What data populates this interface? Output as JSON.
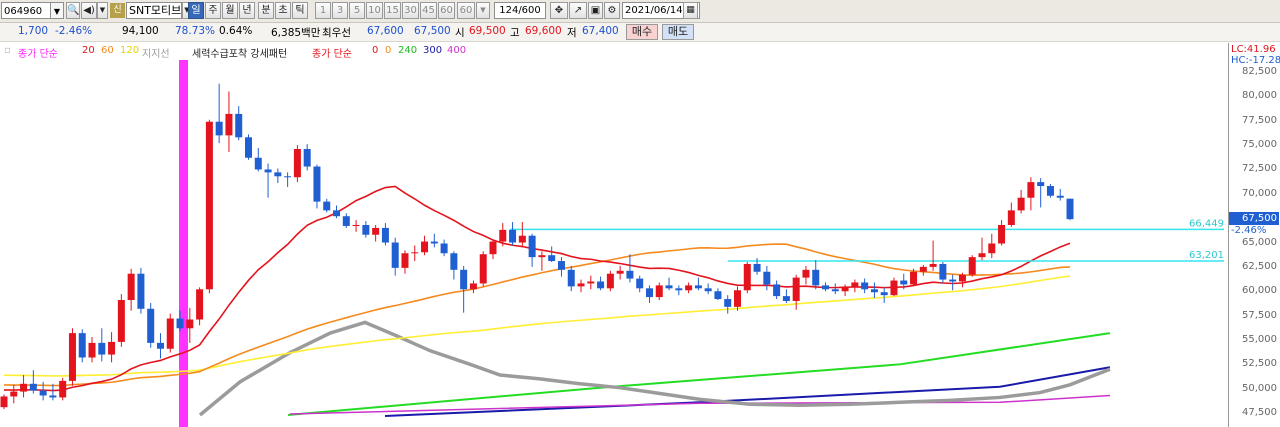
{
  "toolbar": {
    "code": "064960",
    "name": "SNT모티브",
    "sin_badge": "신",
    "periods": [
      {
        "label": "일",
        "active": true
      },
      {
        "label": "주"
      },
      {
        "label": "월"
      },
      {
        "label": "년"
      },
      {
        "label": "분"
      },
      {
        "label": "초"
      },
      {
        "label": "틱"
      }
    ],
    "intervals": [
      "1",
      "3",
      "5",
      "10",
      "15",
      "30",
      "45",
      "60",
      "60"
    ],
    "count": "124",
    "count_total": "/600",
    "date": "2021/06/14"
  },
  "quote": {
    "change": "1,700",
    "change_pct": "-2.46%",
    "volume": "94,100",
    "vol_ratio": "78.73%",
    "turnover": "0.64%",
    "amount": "6,385백만",
    "best_label": "최우선",
    "ask": "67,600",
    "bid": "67,500",
    "open_label": "시",
    "open": "69,500",
    "high_label": "고",
    "high": "69,600",
    "low_label": "저",
    "low": "67,400",
    "buy_label": "매수",
    "sell_label": "매도"
  },
  "legend": {
    "ma_title": "종가 단순",
    "ma_periods": [
      "20",
      "60",
      "120"
    ],
    "support_label": "지지선",
    "indicator_title": "세력수급포착 강세패턴",
    "ind_title2": "종가 단순",
    "ind_periods": [
      "0",
      "0",
      "240",
      "300",
      "400"
    ]
  },
  "axis": {
    "lc_label": "LC:41.96",
    "hc_label": "HC:-17.28",
    "current_price": "67,500",
    "current_pct": "-2.46%",
    "level1": "66,449",
    "level2": "63,201",
    "ticks": [
      "82,500",
      "80,000",
      "77,500",
      "75,000",
      "72,500",
      "70,000",
      "67,500",
      "65,000",
      "62,500",
      "60,000",
      "57,500",
      "55,000",
      "52,500",
      "50,000",
      "47,500"
    ]
  },
  "colors": {
    "up": "#e3141d",
    "down": "#1f5fd1",
    "ma20": "#e3141d",
    "ma60": "#f58a1f",
    "ma120": "#ffee33",
    "signal": "#ff33ff",
    "grey": "#9b9b9b",
    "green": "#22dd22",
    "navy": "#1a1aaa",
    "magenta": "#cc33cc",
    "cyan": "#33e6ee"
  },
  "chart_data": {
    "type": "candlestick",
    "y_range": [
      46500,
      83500
    ],
    "candles": [
      [
        48200,
        49500,
        48000,
        49300
      ],
      [
        49300,
        50500,
        48600,
        49800
      ],
      [
        49800,
        51500,
        49200,
        50600
      ],
      [
        50600,
        52000,
        49600,
        49900
      ],
      [
        49900,
        50800,
        48900,
        49400
      ],
      [
        49400,
        50600,
        48900,
        49200
      ],
      [
        49200,
        51200,
        48900,
        50900
      ],
      [
        50900,
        56300,
        50400,
        55800
      ],
      [
        55800,
        56200,
        52800,
        53300
      ],
      [
        53300,
        55400,
        52800,
        54800
      ],
      [
        54800,
        56300,
        52900,
        53600
      ],
      [
        53600,
        55900,
        52800,
        54900
      ],
      [
        54900,
        59800,
        54400,
        59200
      ],
      [
        59200,
        62400,
        58100,
        61900
      ],
      [
        61900,
        62500,
        57800,
        58300
      ],
      [
        58300,
        58900,
        54300,
        54800
      ],
      [
        54800,
        55800,
        53200,
        54200
      ],
      [
        54200,
        57800,
        53800,
        57300
      ],
      [
        57300,
        58100,
        56000,
        56300
      ],
      [
        56300,
        58400,
        54800,
        57200
      ],
      [
        57200,
        60500,
        56600,
        60300
      ],
      [
        60300,
        77700,
        59900,
        77500
      ],
      [
        77500,
        81400,
        75300,
        76100
      ],
      [
        76100,
        80600,
        74400,
        78300
      ],
      [
        78300,
        79100,
        75600,
        75900
      ],
      [
        75900,
        76200,
        73600,
        73800
      ],
      [
        73800,
        74800,
        72400,
        72600
      ],
      [
        72600,
        73200,
        69700,
        72300
      ],
      [
        72300,
        72700,
        71200,
        71900
      ],
      [
        71900,
        72300,
        70800,
        71800
      ],
      [
        71800,
        75100,
        71300,
        74700
      ],
      [
        74700,
        75200,
        72500,
        72900
      ],
      [
        72900,
        73100,
        68600,
        69300
      ],
      [
        69300,
        69600,
        68200,
        68400
      ],
      [
        68400,
        68900,
        67600,
        67800
      ],
      [
        67800,
        68100,
        66600,
        66800
      ],
      [
        66800,
        67400,
        66200,
        66900
      ],
      [
        66900,
        67300,
        65600,
        65900
      ],
      [
        65900,
        66900,
        65200,
        66600
      ],
      [
        66600,
        67100,
        64800,
        65100
      ],
      [
        65100,
        65600,
        61700,
        62500
      ],
      [
        62500,
        64300,
        61900,
        64000
      ],
      [
        64000,
        64800,
        63200,
        64100
      ],
      [
        64100,
        65800,
        63800,
        65200
      ],
      [
        65200,
        66000,
        64600,
        65000
      ],
      [
        65000,
        65400,
        63700,
        64000
      ],
      [
        64000,
        64200,
        61300,
        62300
      ],
      [
        62300,
        62700,
        57900,
        60300
      ],
      [
        60300,
        61200,
        59900,
        60900
      ],
      [
        60900,
        64200,
        60600,
        63900
      ],
      [
        63900,
        65400,
        63400,
        65200
      ],
      [
        65200,
        67100,
        64700,
        66400
      ],
      [
        66400,
        67200,
        64800,
        65100
      ],
      [
        65100,
        67200,
        64600,
        65800
      ],
      [
        65800,
        66000,
        62600,
        63600
      ],
      [
        63600,
        64200,
        62200,
        63800
      ],
      [
        63800,
        64700,
        63100,
        63200
      ],
      [
        63200,
        63600,
        61600,
        62300
      ],
      [
        62300,
        62700,
        60100,
        60600
      ],
      [
        60600,
        61300,
        60000,
        60900
      ],
      [
        60900,
        61700,
        60300,
        61100
      ],
      [
        61100,
        61600,
        60200,
        60400
      ],
      [
        60400,
        62200,
        60100,
        61900
      ],
      [
        61900,
        62700,
        61300,
        62200
      ],
      [
        62200,
        63900,
        61000,
        61400
      ],
      [
        61400,
        61700,
        60000,
        60400
      ],
      [
        60400,
        60700,
        58900,
        59500
      ],
      [
        59500,
        61000,
        59200,
        60700
      ],
      [
        60700,
        61500,
        60200,
        60400
      ],
      [
        60400,
        60700,
        59700,
        60200
      ],
      [
        60200,
        61000,
        59900,
        60700
      ],
      [
        60700,
        61500,
        60200,
        60400
      ],
      [
        60400,
        60900,
        59800,
        60100
      ],
      [
        60100,
        60400,
        59200,
        59300
      ],
      [
        59300,
        59700,
        57800,
        58500
      ],
      [
        58500,
        60600,
        58100,
        60200
      ],
      [
        60200,
        63100,
        59900,
        62900
      ],
      [
        62900,
        63500,
        61800,
        62100
      ],
      [
        62100,
        62700,
        60200,
        60800
      ],
      [
        60800,
        61200,
        59300,
        59600
      ],
      [
        59600,
        60300,
        58900,
        59100
      ],
      [
        59100,
        61800,
        58200,
        61500
      ],
      [
        61500,
        62700,
        60800,
        62300
      ],
      [
        62300,
        63300,
        60300,
        60700
      ],
      [
        60700,
        61000,
        60100,
        60300
      ],
      [
        60300,
        60900,
        59800,
        60100
      ],
      [
        60100,
        60800,
        59600,
        60500
      ],
      [
        60500,
        61300,
        60000,
        61000
      ],
      [
        61000,
        61400,
        59900,
        60300
      ],
      [
        60300,
        61000,
        59400,
        60000
      ],
      [
        60000,
        60500,
        58900,
        59700
      ],
      [
        59700,
        61500,
        59600,
        61200
      ],
      [
        61200,
        61900,
        60300,
        60800
      ],
      [
        60800,
        62400,
        60700,
        62100
      ],
      [
        62100,
        62800,
        61700,
        62600
      ],
      [
        62600,
        65300,
        62200,
        62900
      ],
      [
        62900,
        63100,
        60900,
        61300
      ],
      [
        61300,
        61800,
        60200,
        61100
      ],
      [
        61100,
        62000,
        60500,
        61800
      ],
      [
        61800,
        63800,
        61600,
        63600
      ],
      [
        63600,
        65600,
        63300,
        64000
      ],
      [
        64000,
        66000,
        63500,
        65000
      ],
      [
        65000,
        67400,
        64800,
        66900
      ],
      [
        66900,
        69200,
        66700,
        68400
      ],
      [
        68400,
        70500,
        68100,
        69700
      ],
      [
        69700,
        71800,
        68400,
        71300
      ],
      [
        71300,
        71700,
        68700,
        70900
      ],
      [
        70900,
        71100,
        69700,
        69900
      ],
      [
        69900,
        70600,
        69400,
        69700
      ],
      [
        69600,
        69600,
        67400,
        67500
      ]
    ],
    "ma20_note": "moving averages approximate",
    "levels": [
      66449,
      63201
    ]
  }
}
